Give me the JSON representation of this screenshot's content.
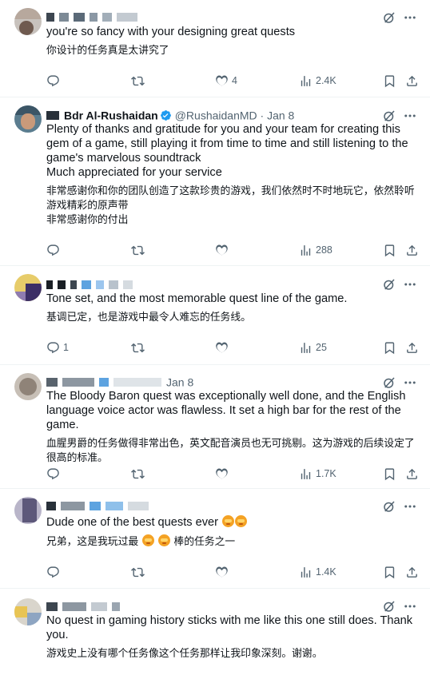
{
  "tweets": [
    {
      "handle": "",
      "date": "",
      "text_en": "you're so fancy with your designing great quests",
      "text_zh": "你设计的任务真是太讲究了",
      "reply_count": "",
      "like_count": "4",
      "views": "2.4K"
    },
    {
      "display_name": "Bdr Al-Rushaidan",
      "handle": "@RushaidanMD",
      "date": "· Jan 8",
      "text_en": "Plenty of thanks and gratitude for you and your team for creating this gem of a game, still playing it from time to time and still listening to the game's marvelous soundtrack",
      "text_en_2": "Much appreciated for your service",
      "text_zh": "非常感谢你和你的团队创造了这款珍贵的游戏，我们依然时不时地玩它，依然聆听游戏精彩的原声带",
      "text_zh_2": "非常感谢你的付出",
      "reply_count": "",
      "like_count": "",
      "views": "288"
    },
    {
      "text_en": "Tone set, and the most memorable quest line of the game.",
      "text_zh": "基调已定，也是游戏中最令人难忘的任务线。",
      "reply_count": "1",
      "like_count": "",
      "views": "25"
    },
    {
      "date": "Jan 8",
      "text_en": "The Bloody Baron quest was exceptionally well done, and the English language voice actor was flawless. It set a high bar for the rest of the game.",
      "text_zh": "血腥男爵的任务做得非常出色，英文配音演员也无可挑剔。这为游戏的后续设定了很高的标准。",
      "reply_count": "",
      "like_count": "",
      "views": "1.7K"
    },
    {
      "text_en": "Dude one of the best quests ever",
      "text_zh_a": "兄弟，这是我玩过最",
      "text_zh_b": "棒的任务之一",
      "reply_count": "",
      "like_count": "",
      "views": "1.4K"
    },
    {
      "text_en": "No quest in gaming history sticks with me like this one still does. Thank you.",
      "text_zh": "游戏史上没有哪个任务像这个任务那样让我印象深刻。谢谢。"
    }
  ],
  "colors": {
    "text": "#0f1419",
    "secondary": "#536471",
    "verified": "#1d9bf0",
    "divider": "#eff3f4"
  }
}
